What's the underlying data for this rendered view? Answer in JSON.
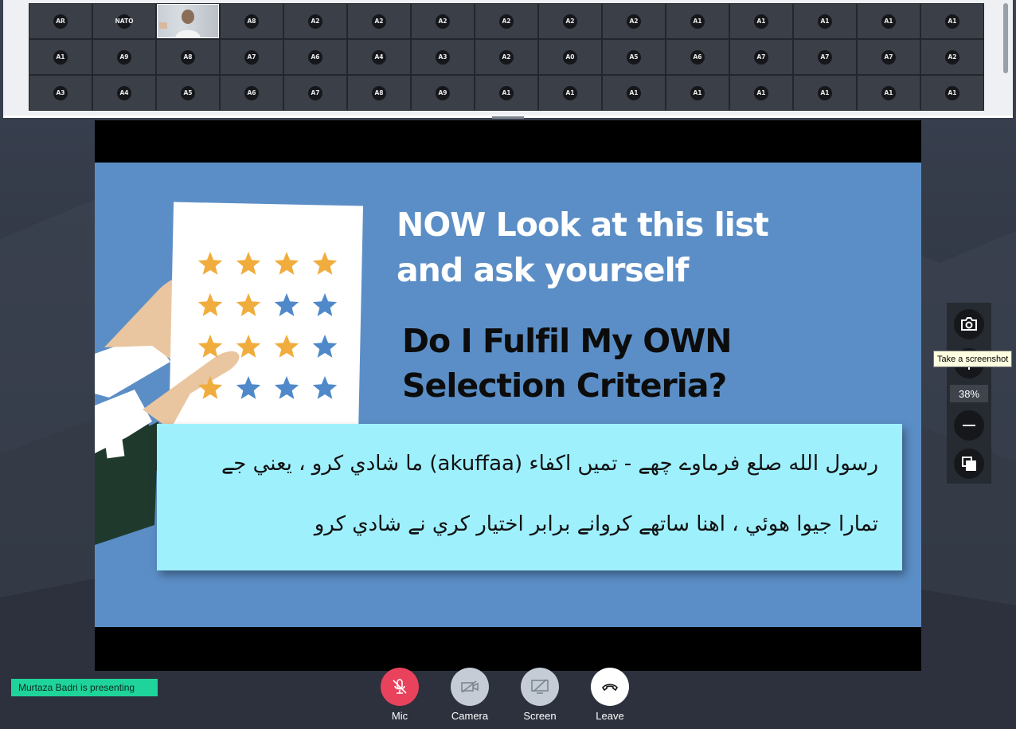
{
  "participants": {
    "rows": [
      [
        "AR",
        "NATO",
        "__video__",
        "A8",
        "A2",
        "A2",
        "A2",
        "A2",
        "A2",
        "A2",
        "A1",
        "A1",
        "A1",
        "A1",
        "A1"
      ],
      [
        "A1",
        "A9",
        "A8",
        "A7",
        "A6",
        "A4",
        "A3",
        "A2",
        "A0",
        "A5",
        "A6",
        "A7",
        "A7",
        "A7",
        "A2"
      ],
      [
        "A3",
        "A4",
        "A5",
        "A6",
        "A7",
        "A8",
        "A9",
        "A1",
        "A1",
        "A1",
        "A1",
        "A1",
        "A1",
        "A1",
        "A1"
      ]
    ]
  },
  "slide": {
    "heading_line1": "NOW Look at this list",
    "heading_line2": "and ask yourself",
    "question_line1": "Do I Fulfil My OWN",
    "question_line2": "Selection Criteria?",
    "urdu_line1": "رسول الله صلع فرماوے چھے - تمیں اکفاء (akuffaa) ما شادي کرو ، يعني جے",
    "urdu_line2": "تمارا جيوا هوئي ، اهنا ساتھے کروانے برابر اختيار کري نے شادي کرو",
    "star_colors": {
      "gold": "#f0ad3d",
      "blue": "#4f89c9"
    }
  },
  "zoom": {
    "screenshot_icon": "camera-icon",
    "zoom_in_icon": "plus-icon",
    "level": "38%",
    "zoom_out_icon": "minus-icon",
    "fit_icon": "copy-icon",
    "tooltip": "Take a screenshot"
  },
  "footer": {
    "presenting": "Murtaza Badri is presenting",
    "mic": "Mic",
    "camera": "Camera",
    "screen": "Screen",
    "leave": "Leave",
    "mic_color": "#e8425c"
  }
}
